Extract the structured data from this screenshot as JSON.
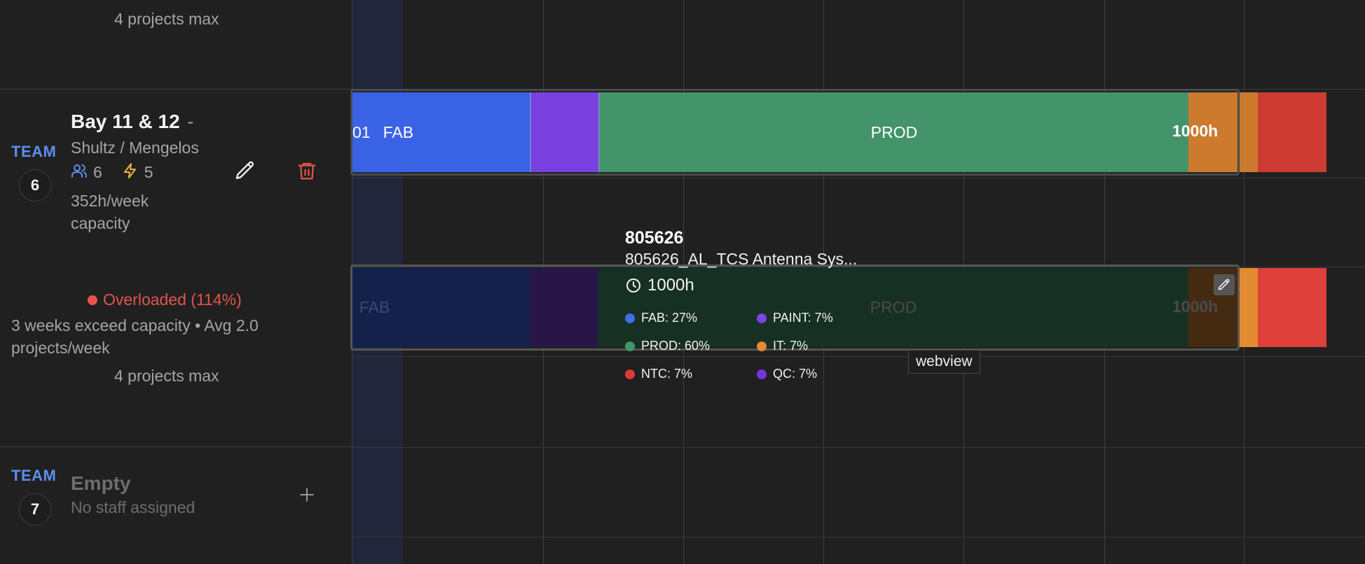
{
  "team_top": {
    "projects_max": "4 projects max"
  },
  "team6": {
    "team_label": "TEAM",
    "team_number": "6",
    "name": "Bay 11 & 12",
    "name_suffix": "-",
    "leads": "Shultz / Mengelos",
    "staff_count": "6",
    "energy_count": "5",
    "capacity_line1": "352h/week",
    "capacity_line2": "capacity",
    "status": "Overloaded (114%)",
    "status_color": "#e5534b",
    "detail_line1": "3 weeks exceed capacity • Avg 2.0",
    "detail_line2": "projects/week",
    "projects_max": "4 projects max"
  },
  "team7": {
    "team_label": "TEAM",
    "team_number": "7",
    "name": "Empty",
    "sub": "No staff assigned"
  },
  "bar1": {
    "left_fragment": "01",
    "fab": "FAB",
    "prod": "PROD",
    "hours": "1000h"
  },
  "bar2": {
    "fab": "FAB",
    "prod": "PROD",
    "hours": "1000h"
  },
  "tooltip": {
    "id": "805626",
    "title": "805626_AL_TCS Antenna Sys...",
    "hours": "1000h",
    "legend": [
      {
        "label": "FAB: 27%",
        "color": "#3f6ee8"
      },
      {
        "label": "PAINT: 7%",
        "color": "#7c45e6"
      },
      {
        "label": "PROD: 60%",
        "color": "#3f9668"
      },
      {
        "label": "IT: 7%",
        "color": "#e48a30"
      },
      {
        "label": "NTC: 7%",
        "color": "#dc3b33"
      },
      {
        "label": "QC: 7%",
        "color": "#7a34d9"
      }
    ]
  },
  "webview_tooltip": "webview",
  "colors": {
    "fab": "#3a62e4",
    "paint": "#7841e0",
    "prod": "#43936b",
    "it": "#cb7a2e",
    "ntc": "#cd3b33",
    "team_accent": "#5b8ff0",
    "delete": "#e5534b"
  }
}
